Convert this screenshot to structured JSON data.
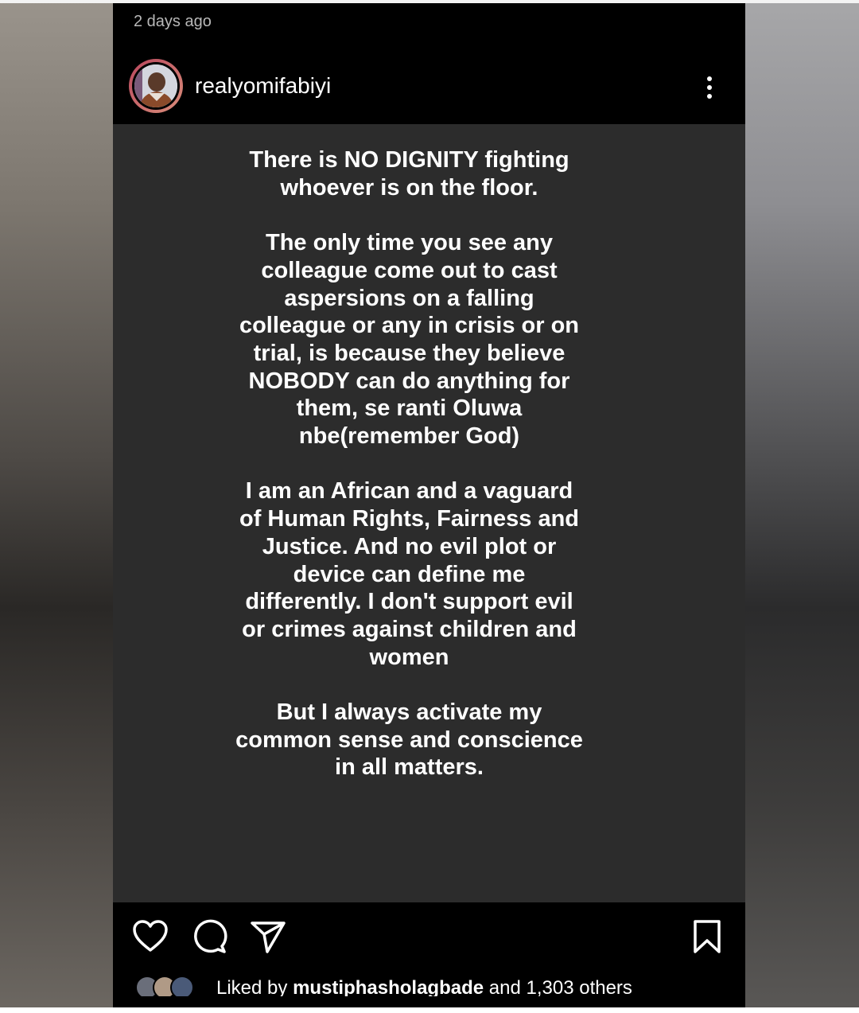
{
  "post": {
    "timestamp": "2 days ago",
    "username": "realyomifabiyi",
    "paragraphs": [
      "There is NO DIGNITY fighting whoever is on the floor.",
      "The only time you see any colleague come out to cast aspersions on a falling colleague or any in crisis or on trial, is because they believe NOBODY can do anything for them, se ranti Oluwa nbe(remember God)",
      "I am an African and a vaguard of Human Rights, Fairness and Justice. And no evil plot or device can define me differently. I don't support evil or crimes against children and women",
      "But I always activate my common sense and conscience in all matters."
    ]
  },
  "likes": {
    "prefix": "Liked by ",
    "user": "mustiphasholagbade",
    "suffix": " and 1,303 others"
  },
  "icons": [
    "more-vertical-icon",
    "heart-icon",
    "comment-icon",
    "share-icon",
    "bookmark-icon"
  ],
  "colors": {
    "app_background": "#000000",
    "post_background": "#2c2c2c",
    "text": "#ffffff",
    "timestamp": "#b8b8b8",
    "avatar_ring": "#c05a68"
  }
}
